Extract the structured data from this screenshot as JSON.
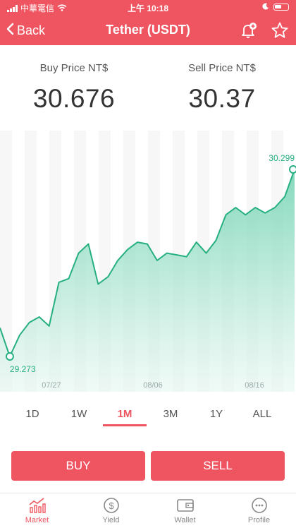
{
  "status": {
    "carrier": "中華電信",
    "time": "上午 10:18"
  },
  "header": {
    "back_label": "Back",
    "title": "Tether (USDT)"
  },
  "prices": {
    "buy_label": "Buy Price NT$",
    "buy_value": "30.676",
    "sell_label": "Sell Price NT$",
    "sell_value": "30.37"
  },
  "chart_data": {
    "type": "area",
    "min_label": "29.273",
    "max_label": "30.299",
    "x_ticks": [
      "07/27",
      "08/06",
      "08/16"
    ],
    "y_range": [
      29.273,
      30.299
    ],
    "values": [
      29.43,
      29.273,
      29.39,
      29.46,
      29.49,
      29.44,
      29.68,
      29.7,
      29.84,
      29.89,
      29.67,
      29.71,
      29.8,
      29.86,
      29.9,
      29.89,
      29.8,
      29.84,
      29.83,
      29.82,
      29.9,
      29.84,
      29.91,
      30.05,
      30.09,
      30.05,
      30.09,
      30.06,
      30.09,
      30.15,
      30.299
    ],
    "color": "#27b07f"
  },
  "ranges": {
    "items": [
      "1D",
      "1W",
      "1M",
      "3M",
      "1Y",
      "ALL"
    ],
    "active": "1M"
  },
  "actions": {
    "buy_label": "BUY",
    "sell_label": "SELL"
  },
  "tabs": [
    {
      "label": "Market",
      "icon": "market-icon",
      "active": true
    },
    {
      "label": "Yield",
      "icon": "yield-icon",
      "active": false
    },
    {
      "label": "Wallet",
      "icon": "wallet-icon",
      "active": false
    },
    {
      "label": "Profile",
      "icon": "profile-icon",
      "active": false
    }
  ],
  "colors": {
    "accent": "#ef5561",
    "chart_line": "#27b07f"
  }
}
